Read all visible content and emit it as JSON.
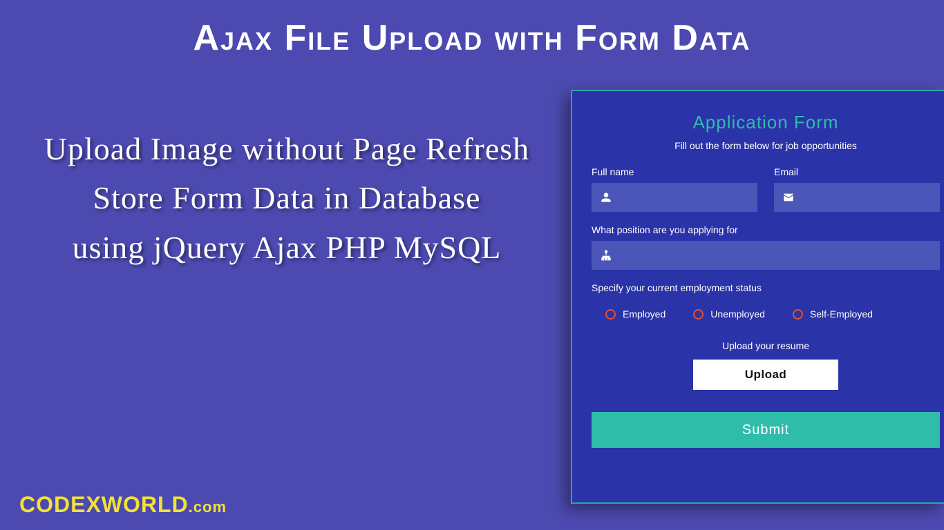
{
  "header": {
    "title": "Ajax File Upload with Form Data"
  },
  "subtext": {
    "line1": "Upload Image without Page Refresh",
    "line2": "Store Form Data in Database",
    "line3": "using jQuery Ajax PHP MySQL"
  },
  "form": {
    "title": "Application Form",
    "subtitle": "Fill out the form below for job opportunities",
    "fields": {
      "fullname_label": "Full name",
      "email_label": "Email",
      "position_label": "What position are you applying for",
      "status_label": "Specify your current employment status"
    },
    "radios": {
      "employed": "Employed",
      "unemployed": "Unemployed",
      "self": "Self-Employed"
    },
    "upload": {
      "label": "Upload your resume",
      "button": "Upload"
    },
    "submit": "Submit"
  },
  "brand": {
    "name": "CODEXWORLD",
    "tld": ".com"
  }
}
